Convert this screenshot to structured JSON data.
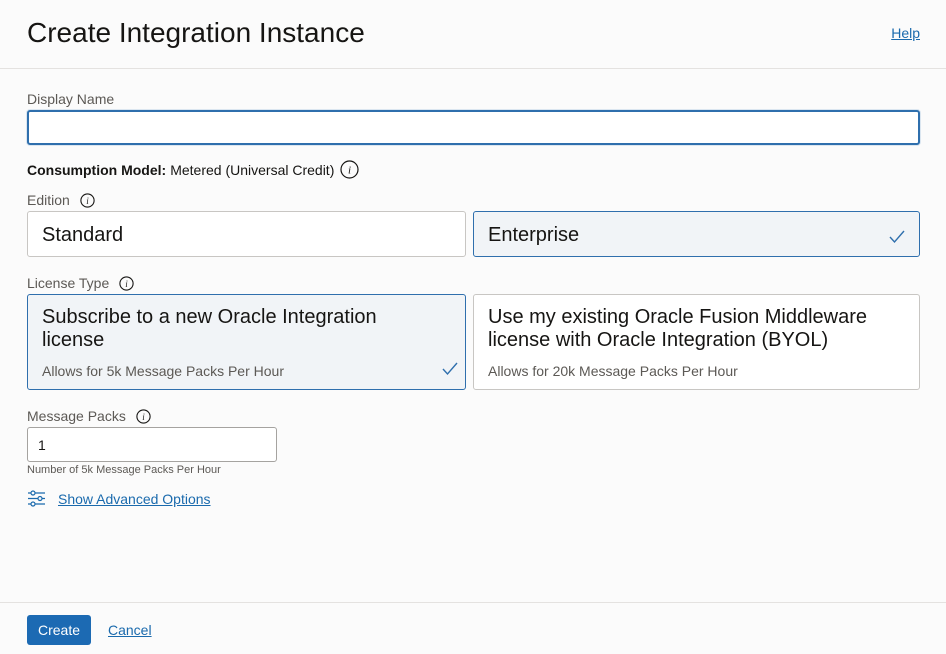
{
  "header": {
    "title": "Create Integration Instance",
    "help_label": "Help"
  },
  "display_name": {
    "label": "Display Name",
    "value": "",
    "placeholder": ""
  },
  "consumption": {
    "label": "Consumption Model:",
    "value": "Metered (Universal Credit)"
  },
  "edition": {
    "label": "Edition",
    "options": [
      {
        "label": "Standard",
        "selected": false
      },
      {
        "label": "Enterprise",
        "selected": true
      }
    ]
  },
  "license_type": {
    "label": "License Type",
    "options": [
      {
        "title": "Subscribe to a new Oracle Integration license",
        "subtitle": "Allows for 5k Message Packs Per Hour",
        "selected": true
      },
      {
        "title": "Use my existing Oracle Fusion Middleware license with Oracle Integration (BYOL)",
        "subtitle": "Allows for 20k Message Packs Per Hour",
        "selected": false
      }
    ]
  },
  "message_packs": {
    "label": "Message Packs",
    "value": "1",
    "helper": "Number of 5k Message Packs Per Hour"
  },
  "advanced": {
    "label": "Show Advanced Options"
  },
  "footer": {
    "create_label": "Create",
    "cancel_label": "Cancel"
  },
  "colors": {
    "accent": "#1c6ab3",
    "link": "#1a6aad",
    "selected_bg": "#f1f4f7",
    "selected_border": "#2f6fad"
  }
}
